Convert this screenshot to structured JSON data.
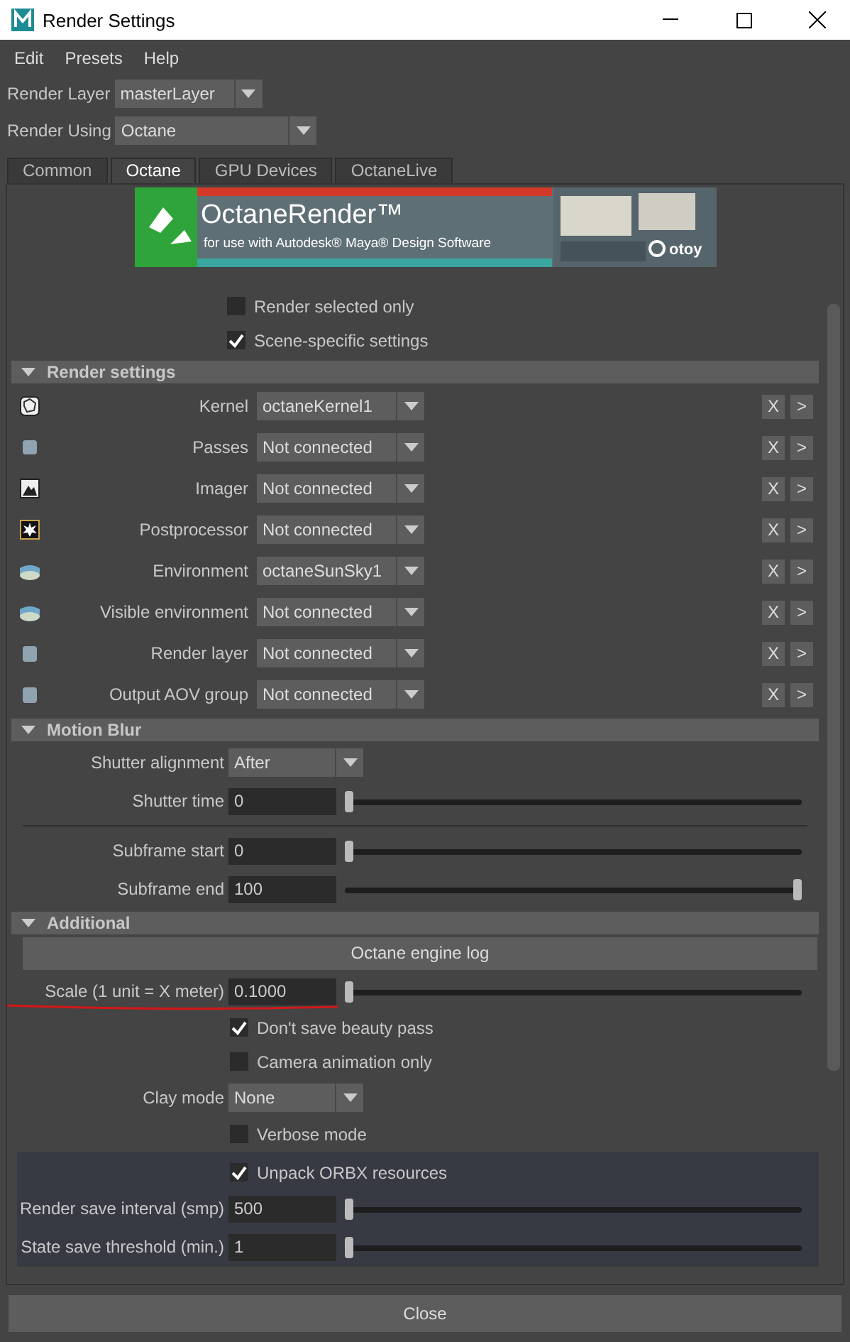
{
  "window": {
    "title": "Render Settings"
  },
  "menu": [
    "Edit",
    "Presets",
    "Help"
  ],
  "render_layer": {
    "label": "Render Layer",
    "value": "masterLayer"
  },
  "render_using": {
    "label": "Render Using",
    "value": "Octane"
  },
  "tabs": [
    {
      "label": "Common",
      "selected": false
    },
    {
      "label": "Octane",
      "selected": true
    },
    {
      "label": "GPU Devices",
      "selected": false
    },
    {
      "label": "OctaneLive",
      "selected": false
    }
  ],
  "banner": {
    "title": "OctaneRender™",
    "subtitle": "for use with Autodesk® Maya® Design Software",
    "brand": "otoy"
  },
  "top_options": [
    {
      "label": "Render selected only",
      "checked": false
    },
    {
      "label": "Scene-specific settings",
      "checked": true
    }
  ],
  "render_settings": {
    "title": "Render settings",
    "expanded": true,
    "rows": [
      {
        "label": "Kernel",
        "value": "octaneKernel1",
        "clear": "X",
        "open": ">"
      },
      {
        "label": "Passes",
        "value": "Not connected",
        "clear": "X",
        "open": ">"
      },
      {
        "label": "Imager",
        "value": "Not connected",
        "clear": "X",
        "open": ">"
      },
      {
        "label": "Postprocessor",
        "value": "Not connected",
        "clear": "X",
        "open": ">"
      },
      {
        "label": "Environment",
        "value": "octaneSunSky1",
        "clear": "X",
        "open": ">"
      },
      {
        "label": "Visible environment",
        "value": "Not connected",
        "clear": "X",
        "open": ">"
      },
      {
        "label": "Render layer",
        "value": "Not connected",
        "clear": "X",
        "open": ">"
      },
      {
        "label": "Output AOV group",
        "value": "Not connected",
        "clear": "X",
        "open": ">"
      }
    ]
  },
  "motion_blur": {
    "title": "Motion Blur",
    "expanded": true,
    "items": [
      {
        "kind": "dropdown",
        "label": "Shutter alignment",
        "value": "After"
      },
      {
        "kind": "slider",
        "label": "Shutter time",
        "value": "0",
        "level": 0
      },
      {
        "kind": "separator"
      },
      {
        "kind": "slider",
        "label": "Subframe start",
        "value": "0",
        "level": 0
      },
      {
        "kind": "slider",
        "label": "Subframe end",
        "value": "100",
        "level": 1
      }
    ]
  },
  "additional": {
    "title": "Additional",
    "expanded": true,
    "items": [
      {
        "kind": "button",
        "label": "Octane engine log"
      },
      {
        "kind": "slider",
        "label": "Scale (1 unit = X meter)",
        "value": "0.1000",
        "level": 0,
        "underlined": true
      },
      {
        "kind": "checkbox",
        "label": "Don't save beauty pass",
        "checked": true
      },
      {
        "kind": "checkbox",
        "label": "Camera animation only",
        "checked": false
      },
      {
        "kind": "dropdown",
        "label": "Clay mode",
        "value": "None"
      },
      {
        "kind": "checkbox",
        "label": "Verbose mode",
        "checked": false
      },
      {
        "kind": "panel",
        "items": [
          {
            "kind": "checkbox",
            "label": "Unpack ORBX resources",
            "checked": true
          },
          {
            "kind": "slider",
            "label": "Render save interval (smp)",
            "value": "500",
            "level": 0
          },
          {
            "kind": "slider",
            "label": "State save threshold (min.)",
            "value": "1",
            "level": 0
          }
        ]
      }
    ]
  },
  "close_button": "Close"
}
